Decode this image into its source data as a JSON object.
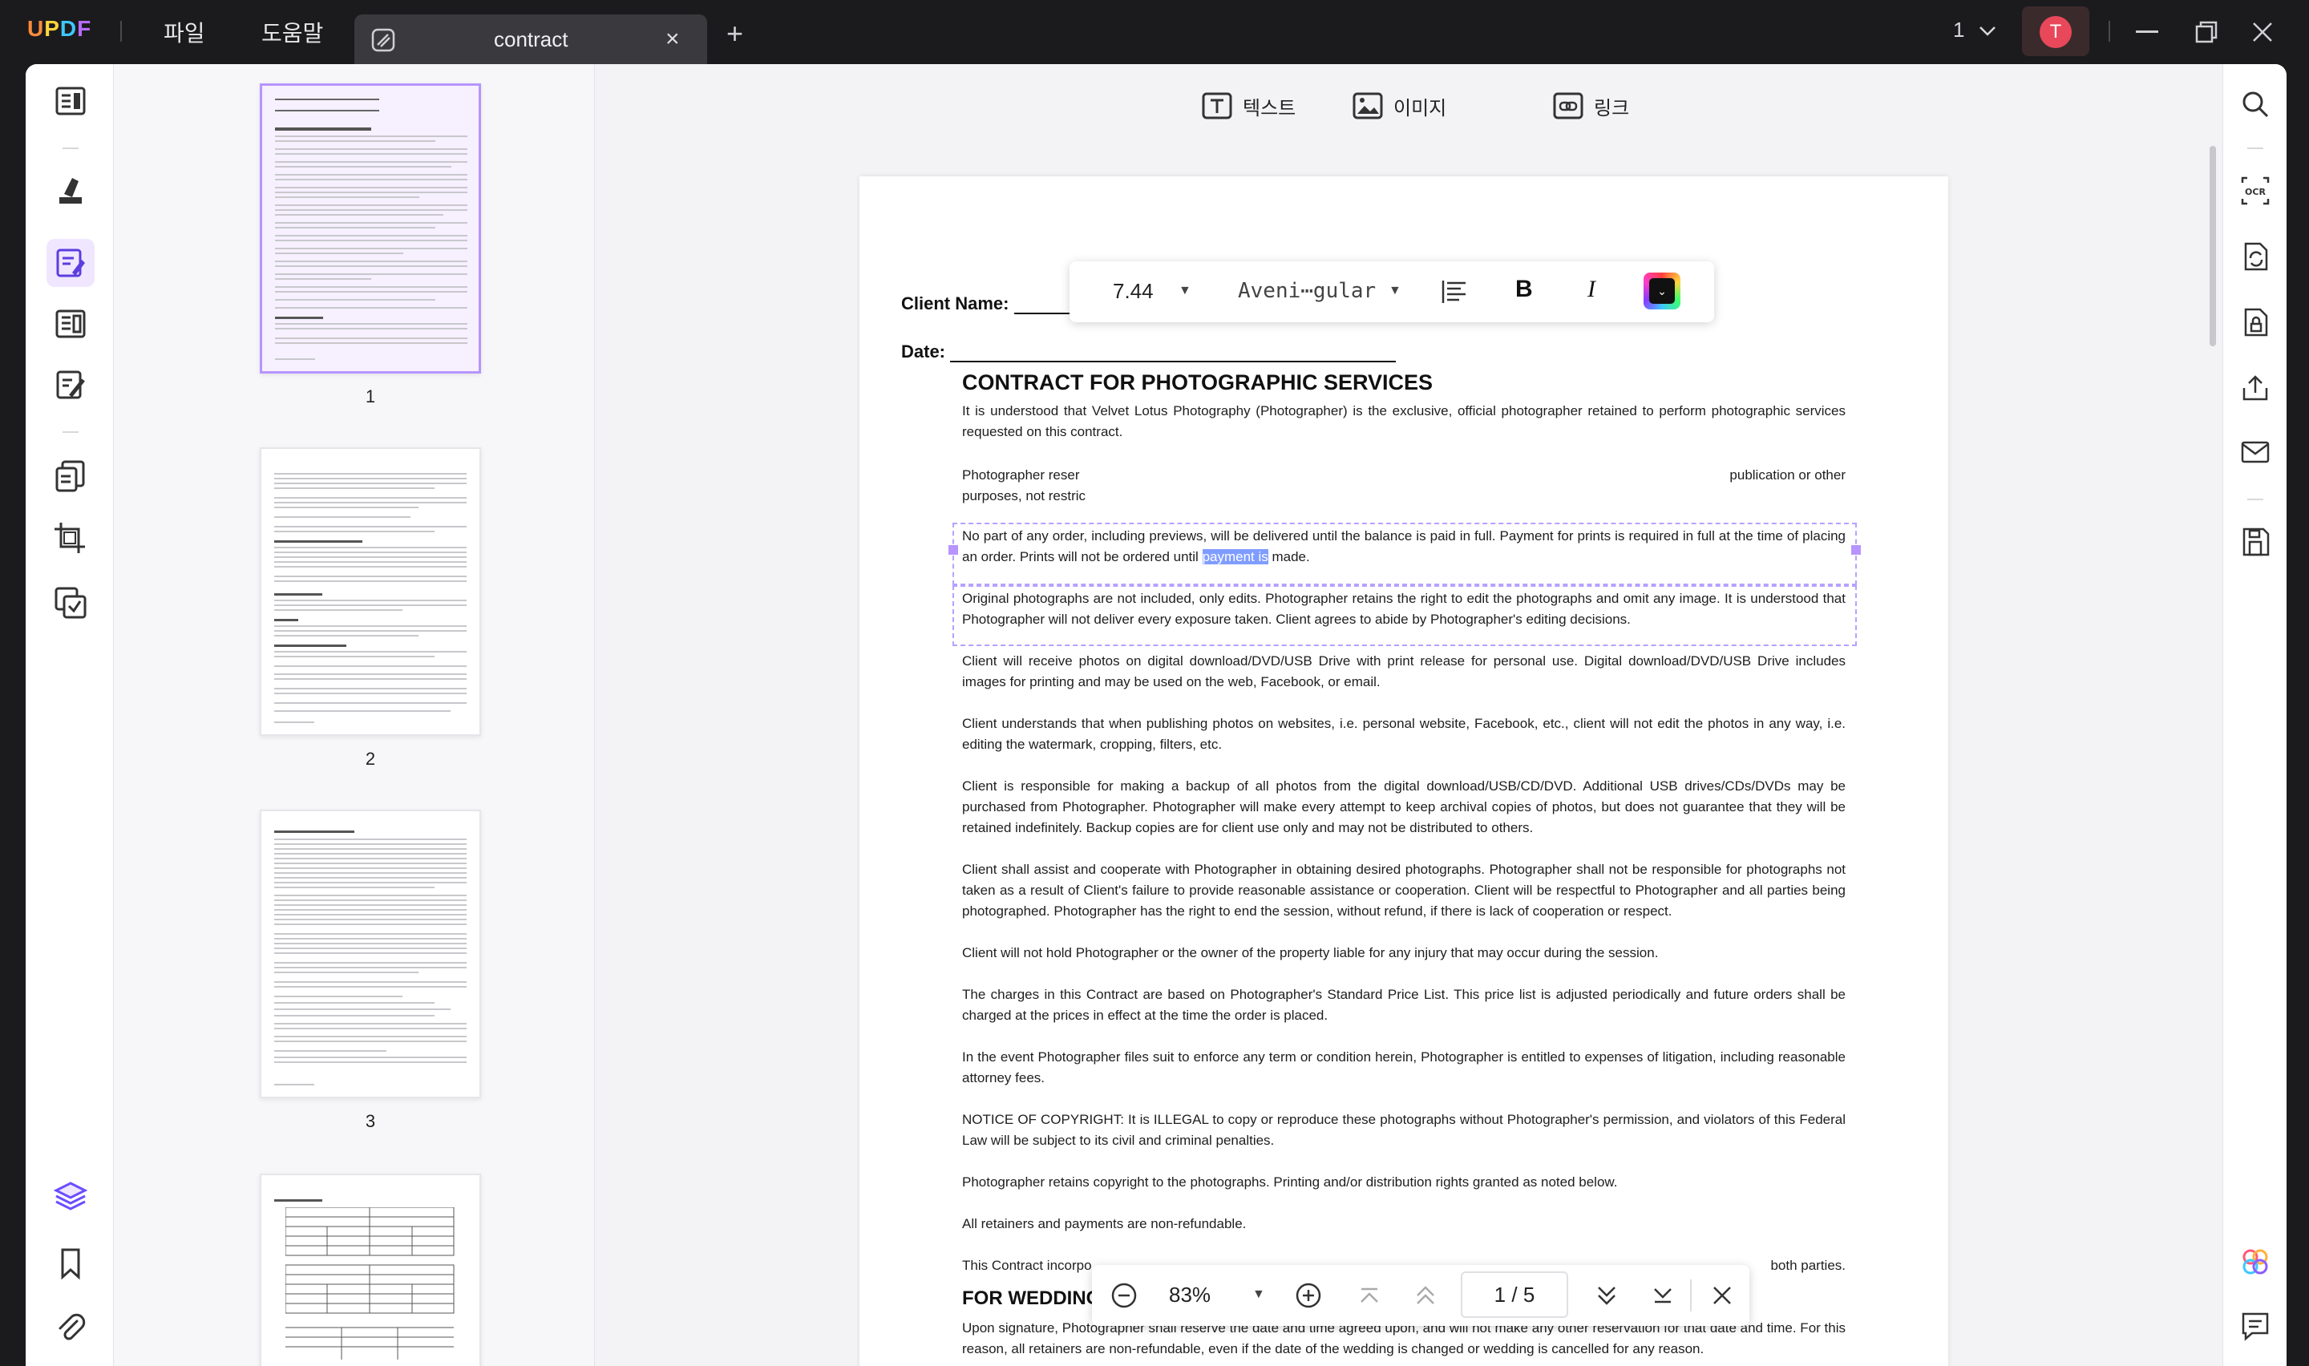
{
  "app": {
    "logo": [
      "U",
      "P",
      "D",
      "F"
    ]
  },
  "menu": {
    "file": "파일",
    "help": "도움말"
  },
  "tab": {
    "title": "contract",
    "close": "×",
    "add": "+"
  },
  "header": {
    "page_selector": "1",
    "avatar_initial": "T"
  },
  "edit_toolbar": {
    "text": "텍스트",
    "image": "이미지",
    "link": "링크"
  },
  "font_toolbar": {
    "size": "7.44",
    "font_name": "Aveni⋯gular",
    "bold": "B",
    "italic": "I"
  },
  "thumbnails": [
    {
      "num": "1"
    },
    {
      "num": "2"
    },
    {
      "num": "3"
    }
  ],
  "document": {
    "client_name_label": "Client Name:",
    "date_label": "Date:",
    "title": "CONTRACT FOR PHOTOGRAPHIC SERVICES",
    "p1": "It is understood that Velvet Lotus Photography (Photographer) is the exclusive, official photographer retained to perform photographic services requested on this contract.",
    "p2_start": "Photographer reser",
    "p2_end": "publication or other",
    "p2_line2": "purposes, not restric",
    "p3_a": "No part of any order, including previews, will be delivered until the balance is paid in full. Payment for prints is required in full at the time of placing an order. Prints will not be ordered until ",
    "p3_sel": "payment is",
    "p3_b": " made.",
    "p4": "Original photographs are not included, only edits. Photographer retains the right to edit the photographs and omit any image. It is understood that Photographer will not deliver every exposure taken. Client agrees to abide by Photographer's editing decisions.",
    "p5": "Client will receive photos on digital download/DVD/USB Drive with print release for personal use. Digital download/DVD/USB Drive includes images for printing and may be used on the web, Facebook, or email.",
    "p6": "Client understands that when publishing photos on websites, i.e. personal website, Facebook, etc., client will not edit the photos in any way, i.e. editing the watermark, cropping, filters, etc.",
    "p7": "Client is responsible for making a backup of all photos from the digital download/USB/CD/DVD. Additional USB drives/CDs/DVDs may be purchased from Photographer. Photographer will make every attempt to keep archival copies of photos, but does not guarantee that they will be retained indefinitely. Backup copies are for client use only and may not be distributed to others.",
    "p8": "Client shall assist and cooperate with Photographer in obtaining desired photographs. Photographer shall not be responsible for photographs not taken as a result of Client's failure to provide reasonable assistance or cooperation. Client will be respectful to Photographer and all parties being photographed. Photographer has the right to end the session, without refund, if there is lack of cooperation or respect.",
    "p9": "Client will not hold Photographer or the owner of the property liable for any injury that may occur during the session.",
    "p10": "The charges in this Contract are based on Photographer's Standard Price List. This price list is adjusted periodically and future orders shall be charged at the prices in effect at the time the order is placed.",
    "p11": "In the event Photographer files suit to enforce any term or condition herein, Photographer is entitled to expenses of litigation, including reasonable attorney fees.",
    "p12": "NOTICE OF COPYRIGHT: It is ILLEGAL to copy or reproduce these photographs without Photographer's permission, and violators of this Federal Law will be subject to its civil and criminal penalties.",
    "p13": "Photographer retains copyright to the photographs. Printing and/or distribution rights granted as noted below.",
    "p14": "All retainers and payments are non-refundable.",
    "p15_start": "This Contract incorpo",
    "p15_end": "both parties.",
    "h2": "FOR WEDDING",
    "p16": "Upon signature, Photographer shall reserve the date and time agreed upon, and will not make any other reservation for that date and time. For this reason, all retainers are non-refundable, even if the date of the wedding is changed or wedding is cancelled for any reason."
  },
  "nav": {
    "zoom": "83%",
    "current_page": "1",
    "sep": "/",
    "total_pages": "5"
  }
}
